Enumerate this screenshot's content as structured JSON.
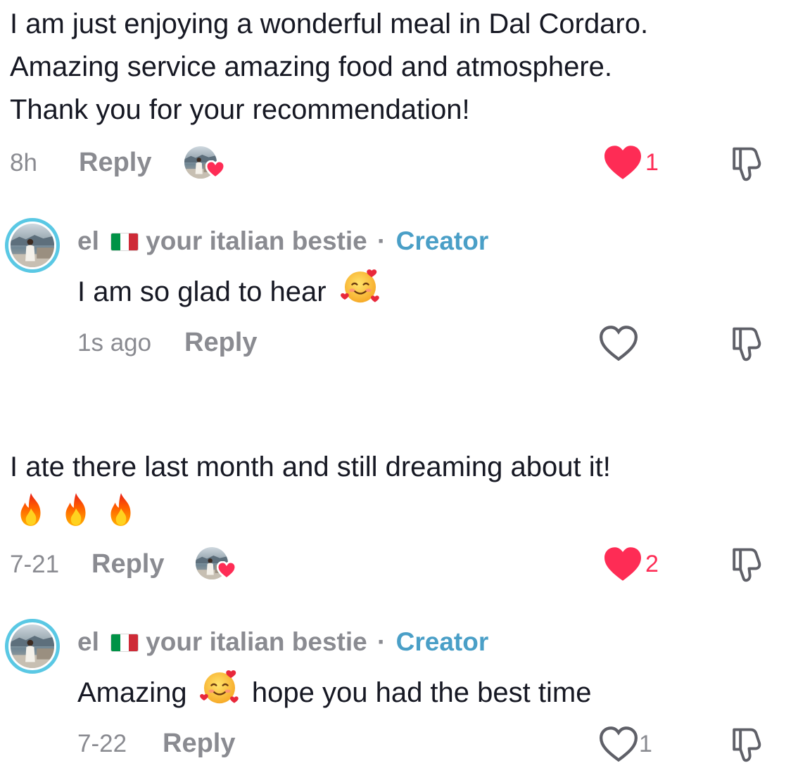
{
  "comments": [
    {
      "text_lines": [
        "I am just enjoying a wonderful meal in Dal Cordaro.",
        "Amazing service amazing food and atmosphere.",
        "Thank you for your recommendation!"
      ],
      "time": "8h",
      "reply_label": "Reply",
      "like_count": "1",
      "liked": true,
      "liked_by_creator": true,
      "reply": {
        "author_name": "el",
        "author_flag": "italy-flag",
        "author_handle": "your italian bestie",
        "separator": "·",
        "badge": "Creator",
        "text": "I am so glad to hear",
        "emoji": "smiling-face-with-hearts",
        "time": "1s ago",
        "reply_label": "Reply",
        "like_count": "",
        "liked": false
      }
    },
    {
      "text_lines": [
        "I ate there last month and still dreaming about it!"
      ],
      "emoji_line": [
        "fire",
        "fire",
        "fire"
      ],
      "time": "7-21",
      "reply_label": "Reply",
      "like_count": "2",
      "liked": true,
      "liked_by_creator": true,
      "reply": {
        "author_name": "el",
        "author_flag": "italy-flag",
        "author_handle": "your italian bestie",
        "separator": "·",
        "badge": "Creator",
        "text_before": "Amazing",
        "emoji": "smiling-face-with-hearts",
        "text_after": "hope you had the best time",
        "time": "7-22",
        "reply_label": "Reply",
        "like_count": "1",
        "liked": false
      }
    }
  ],
  "colors": {
    "heart_red": "#fe2c55",
    "creator_blue": "#4a9fc7",
    "meta_gray": "#8a8b91",
    "text_dark": "#161823",
    "avatar_ring": "#5ac8e4"
  }
}
